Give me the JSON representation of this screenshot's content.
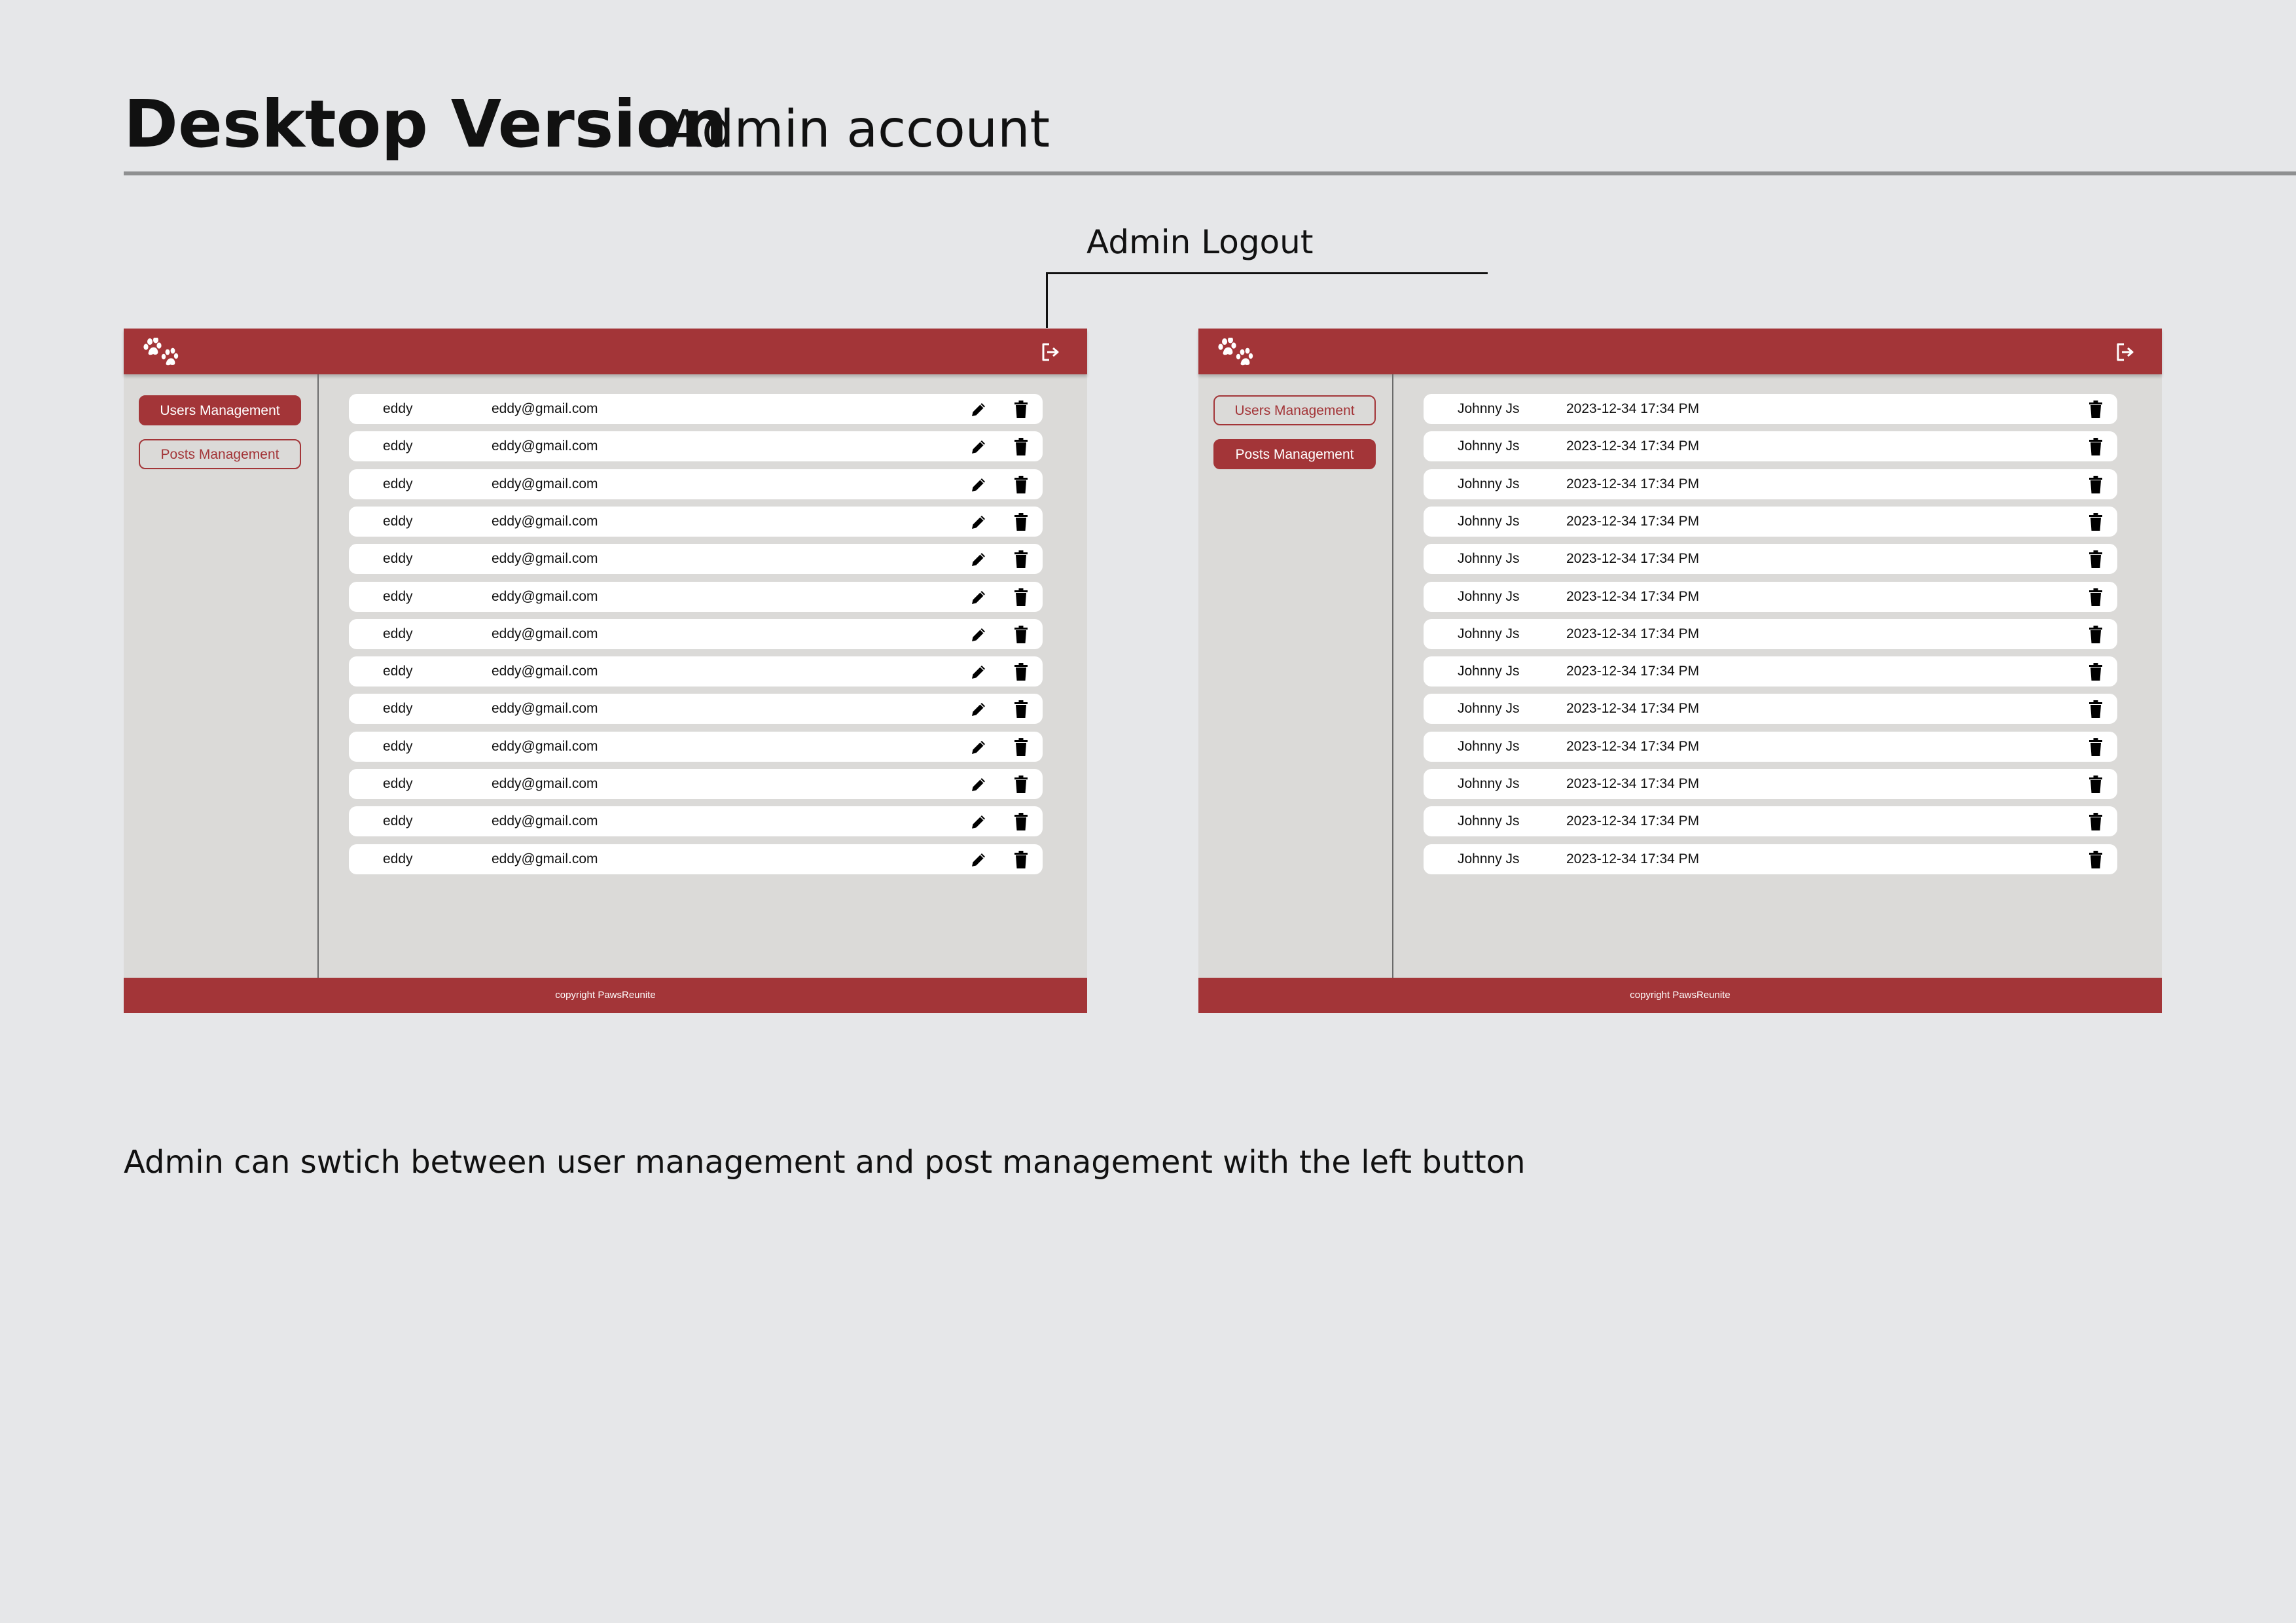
{
  "header": {
    "title": "Desktop Version",
    "subtitle": "Admin account"
  },
  "callout": {
    "label": "Admin Logout"
  },
  "note": "Admin can swtich between user management and post management with the left button",
  "colors": {
    "brand": "#a33538",
    "panel_background": "#dbdad8",
    "row_background": "#ffffff",
    "page_background": "#e6e7e9"
  },
  "icons": {
    "logo": "paw-logo-icon",
    "logout": "logout-icon",
    "edit": "pencil-icon",
    "delete": "trash-icon"
  },
  "users_screen": {
    "sidebar": {
      "users_btn": "Users Management",
      "posts_btn": "Posts Management",
      "active": "users"
    },
    "rows": [
      {
        "name": "eddy",
        "email": "eddy@gmail.com"
      },
      {
        "name": "eddy",
        "email": "eddy@gmail.com"
      },
      {
        "name": "eddy",
        "email": "eddy@gmail.com"
      },
      {
        "name": "eddy",
        "email": "eddy@gmail.com"
      },
      {
        "name": "eddy",
        "email": "eddy@gmail.com"
      },
      {
        "name": "eddy",
        "email": "eddy@gmail.com"
      },
      {
        "name": "eddy",
        "email": "eddy@gmail.com"
      },
      {
        "name": "eddy",
        "email": "eddy@gmail.com"
      },
      {
        "name": "eddy",
        "email": "eddy@gmail.com"
      },
      {
        "name": "eddy",
        "email": "eddy@gmail.com"
      },
      {
        "name": "eddy",
        "email": "eddy@gmail.com"
      },
      {
        "name": "eddy",
        "email": "eddy@gmail.com"
      },
      {
        "name": "eddy",
        "email": "eddy@gmail.com"
      }
    ],
    "footer": "copyright PawsReunite"
  },
  "posts_screen": {
    "sidebar": {
      "users_btn": "Users Management",
      "posts_btn": "Posts Management",
      "active": "posts"
    },
    "rows": [
      {
        "author": "Johnny Js",
        "date": "2023-12-34 17:34 PM"
      },
      {
        "author": "Johnny Js",
        "date": "2023-12-34 17:34 PM"
      },
      {
        "author": "Johnny Js",
        "date": "2023-12-34 17:34 PM"
      },
      {
        "author": "Johnny Js",
        "date": "2023-12-34 17:34 PM"
      },
      {
        "author": "Johnny Js",
        "date": "2023-12-34 17:34 PM"
      },
      {
        "author": "Johnny Js",
        "date": "2023-12-34 17:34 PM"
      },
      {
        "author": "Johnny Js",
        "date": "2023-12-34 17:34 PM"
      },
      {
        "author": "Johnny Js",
        "date": "2023-12-34 17:34 PM"
      },
      {
        "author": "Johnny Js",
        "date": "2023-12-34 17:34 PM"
      },
      {
        "author": "Johnny Js",
        "date": "2023-12-34 17:34 PM"
      },
      {
        "author": "Johnny Js",
        "date": "2023-12-34 17:34 PM"
      },
      {
        "author": "Johnny Js",
        "date": "2023-12-34 17:34 PM"
      },
      {
        "author": "Johnny Js",
        "date": "2023-12-34 17:34 PM"
      }
    ],
    "footer": "copyright PawsReunite"
  }
}
